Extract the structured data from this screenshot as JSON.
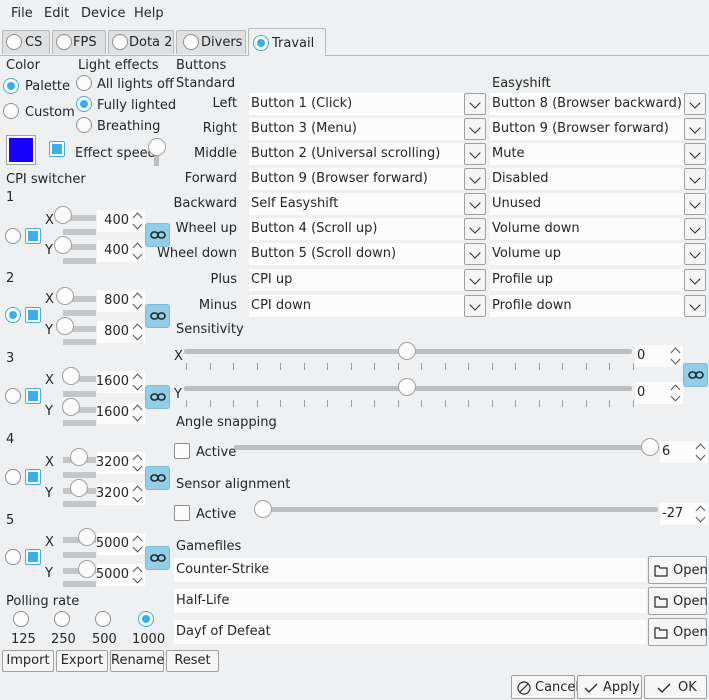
{
  "menu": [
    "File",
    "Edit",
    "Device",
    "Help"
  ],
  "tabs": [
    "CS",
    "FPS",
    "Dota 2",
    "Divers",
    "Travail"
  ],
  "color": {
    "title": "Color",
    "palette": "Palette",
    "custom": "Custom",
    "swatch_hex": "#1a00ff"
  },
  "light": {
    "title": "Light effects",
    "all_off": "All lights off",
    "fully": "Fully lighted",
    "breathing": "Breathing",
    "effect_speed": "Effect speed"
  },
  "cpi": {
    "title": "CPI switcher",
    "x": "X",
    "y": "Y",
    "levels": [
      {
        "n": "1",
        "x": "400",
        "y": "400"
      },
      {
        "n": "2",
        "x": "800",
        "y": "800"
      },
      {
        "n": "3",
        "x": "1600",
        "y": "1600"
      },
      {
        "n": "4",
        "x": "3200",
        "y": "3200"
      },
      {
        "n": "5",
        "x": "5000",
        "y": "5000"
      }
    ]
  },
  "polling": {
    "title": "Polling rate",
    "rates": [
      "125",
      "250",
      "500",
      "1000"
    ]
  },
  "bottom_buttons": {
    "import": "Import",
    "export": "Export",
    "rename": "Rename",
    "reset": "Reset"
  },
  "buttons": {
    "title": "Buttons",
    "standard": "Standard",
    "easyshift": "Easyshift",
    "rows": [
      {
        "label": "Left",
        "std": "Button 1 (Click)",
        "es": "Button 8 (Browser backward)"
      },
      {
        "label": "Right",
        "std": "Button 3 (Menu)",
        "es": "Button 9 (Browser forward)"
      },
      {
        "label": "Middle",
        "std": "Button 2 (Universal scrolling)",
        "es": "Mute"
      },
      {
        "label": "Forward",
        "std": "Button 9 (Browser forward)",
        "es": "Disabled"
      },
      {
        "label": "Backward",
        "std": "Self Easyshift",
        "es": "Unused"
      },
      {
        "label": "Wheel up",
        "std": "Button 4 (Scroll up)",
        "es": "Volume down"
      },
      {
        "label": "Wheel down",
        "std": "Button 5 (Scroll down)",
        "es": "Volume up"
      },
      {
        "label": "Plus",
        "std": "CPI up",
        "es": "Profile up"
      },
      {
        "label": "Minus",
        "std": "CPI down",
        "es": "Profile down"
      }
    ]
  },
  "sensitivity": {
    "title": "Sensitivity",
    "x": "X",
    "y": "Y",
    "x_value": "0",
    "y_value": "0"
  },
  "angle": {
    "title": "Angle snapping",
    "active": "Active",
    "value": "6"
  },
  "sensor": {
    "title": "Sensor alignment",
    "active": "Active",
    "value": "-27"
  },
  "gamefiles": {
    "title": "Gamefiles",
    "open": "Open",
    "files": [
      "Counter-Strike",
      "Half-Life",
      "Dayf of Defeat"
    ]
  },
  "dialog": {
    "cancel": "Cancel",
    "apply": "Apply",
    "ok": "OK"
  },
  "colors": {
    "accent": "#3daee9",
    "link_button": "#93cee9"
  }
}
